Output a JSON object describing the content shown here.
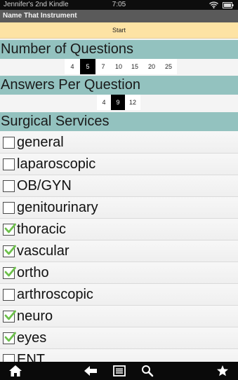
{
  "status_bar": {
    "device_name": "Jennifer's 2nd Kindle",
    "time": "7:05"
  },
  "app": {
    "title": "Name That Instrument"
  },
  "start_button": {
    "label": "Start"
  },
  "questions": {
    "header": "Number of Questions",
    "options": [
      "4",
      "5",
      "7",
      "10",
      "15",
      "20",
      "25"
    ],
    "selected": "5"
  },
  "answers": {
    "header": "Answers Per Question",
    "options": [
      "4",
      "9",
      "12"
    ],
    "selected": "9"
  },
  "services": {
    "header": "Surgical Services",
    "items": [
      {
        "label": "general",
        "checked": false
      },
      {
        "label": "laparoscopic",
        "checked": false
      },
      {
        "label": "OB/GYN",
        "checked": false
      },
      {
        "label": "genitourinary",
        "checked": false
      },
      {
        "label": "thoracic",
        "checked": true
      },
      {
        "label": "vascular",
        "checked": true
      },
      {
        "label": "ortho",
        "checked": true
      },
      {
        "label": "arthroscopic",
        "checked": false
      },
      {
        "label": "neuro",
        "checked": true
      },
      {
        "label": "eyes",
        "checked": true
      },
      {
        "label": "ENT",
        "checked": false
      }
    ]
  },
  "colors": {
    "header_bg": "#93c2bf",
    "start_bg": "#fde3a4",
    "check_green": "#6cc04a",
    "selected_bg": "#000000"
  },
  "nav": {
    "icons": [
      "home-icon",
      "back-icon",
      "menu-icon",
      "search-icon",
      "favorites-icon"
    ]
  }
}
